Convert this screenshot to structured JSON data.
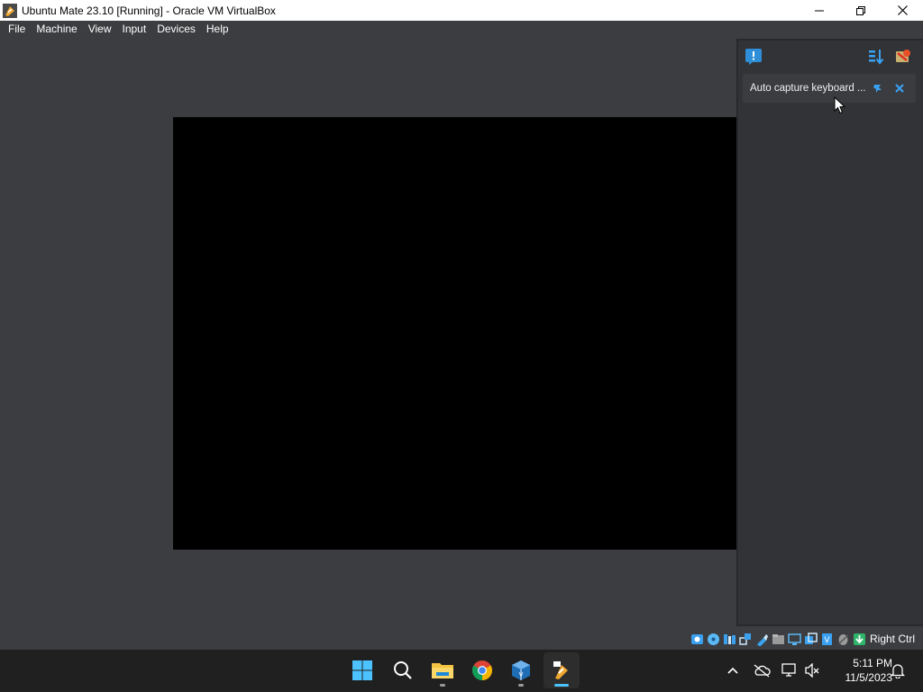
{
  "window": {
    "title": "Ubuntu Mate 23.10 [Running] - Oracle VM VirtualBox"
  },
  "menu": {
    "items": [
      "File",
      "Machine",
      "View",
      "Input",
      "Devices",
      "Help"
    ]
  },
  "notification_center": {
    "card_text": "Auto capture keyboard ..."
  },
  "status_bar": {
    "host_key": "Right Ctrl",
    "icons": [
      "hard-disk-icon",
      "optical-drive-icon",
      "audio-icon",
      "network-icon",
      "usb-icon",
      "shared-folders-icon",
      "display-icon",
      "recording-icon",
      "cpu-icon",
      "mouse-integration-icon",
      "keyboard-capture-icon"
    ]
  },
  "taskbar": {
    "apps": [
      "start-button",
      "search-button",
      "file-explorer",
      "chrome",
      "virtualbox-manager",
      "virtualbox-vm"
    ],
    "time": "5:11 PM",
    "date": "11/5/2023"
  },
  "colors": {
    "background": "#3c3d40",
    "panel": "#323336",
    "accent": "#4cc2ff"
  }
}
